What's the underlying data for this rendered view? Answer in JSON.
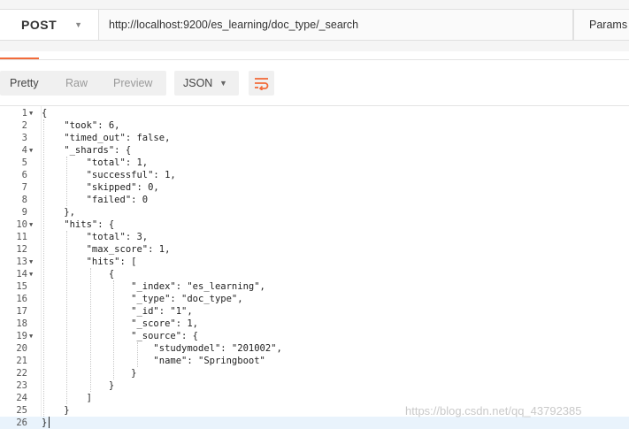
{
  "request": {
    "method": "POST",
    "url": "http://localhost:9200/es_learning/doc_type/_search",
    "params_label": "Params"
  },
  "response_toolbar": {
    "view_modes": [
      "Pretty",
      "Raw",
      "Preview"
    ],
    "format": "JSON"
  },
  "code_lines": [
    {
      "n": "1",
      "fold": true,
      "text": "{"
    },
    {
      "n": "2",
      "fold": false,
      "text": "    \"took\": 6,"
    },
    {
      "n": "3",
      "fold": false,
      "text": "    \"timed_out\": false,"
    },
    {
      "n": "4",
      "fold": true,
      "text": "    \"_shards\": {"
    },
    {
      "n": "5",
      "fold": false,
      "text": "        \"total\": 1,"
    },
    {
      "n": "6",
      "fold": false,
      "text": "        \"successful\": 1,"
    },
    {
      "n": "7",
      "fold": false,
      "text": "        \"skipped\": 0,"
    },
    {
      "n": "8",
      "fold": false,
      "text": "        \"failed\": 0"
    },
    {
      "n": "9",
      "fold": false,
      "text": "    },"
    },
    {
      "n": "10",
      "fold": true,
      "text": "    \"hits\": {"
    },
    {
      "n": "11",
      "fold": false,
      "text": "        \"total\": 3,"
    },
    {
      "n": "12",
      "fold": false,
      "text": "        \"max_score\": 1,"
    },
    {
      "n": "13",
      "fold": true,
      "text": "        \"hits\": ["
    },
    {
      "n": "14",
      "fold": true,
      "text": "            {"
    },
    {
      "n": "15",
      "fold": false,
      "text": "                \"_index\": \"es_learning\","
    },
    {
      "n": "16",
      "fold": false,
      "text": "                \"_type\": \"doc_type\","
    },
    {
      "n": "17",
      "fold": false,
      "text": "                \"_id\": \"1\","
    },
    {
      "n": "18",
      "fold": false,
      "text": "                \"_score\": 1,"
    },
    {
      "n": "19",
      "fold": true,
      "text": "                \"_source\": {"
    },
    {
      "n": "20",
      "fold": false,
      "text": "                    \"studymodel\": \"201002\","
    },
    {
      "n": "21",
      "fold": false,
      "text": "                    \"name\": \"Springboot\""
    },
    {
      "n": "22",
      "fold": false,
      "text": "                }"
    },
    {
      "n": "23",
      "fold": false,
      "text": "            }"
    },
    {
      "n": "24",
      "fold": false,
      "text": "        ]"
    },
    {
      "n": "25",
      "fold": false,
      "text": "    }"
    },
    {
      "n": "26",
      "fold": false,
      "text": "}"
    }
  ],
  "active_line": "26",
  "watermark": "https://blog.csdn.net/qq_43792385",
  "colors": {
    "tab_accent": "#f26b3a",
    "active_line_bg": "#e9f3fc"
  }
}
